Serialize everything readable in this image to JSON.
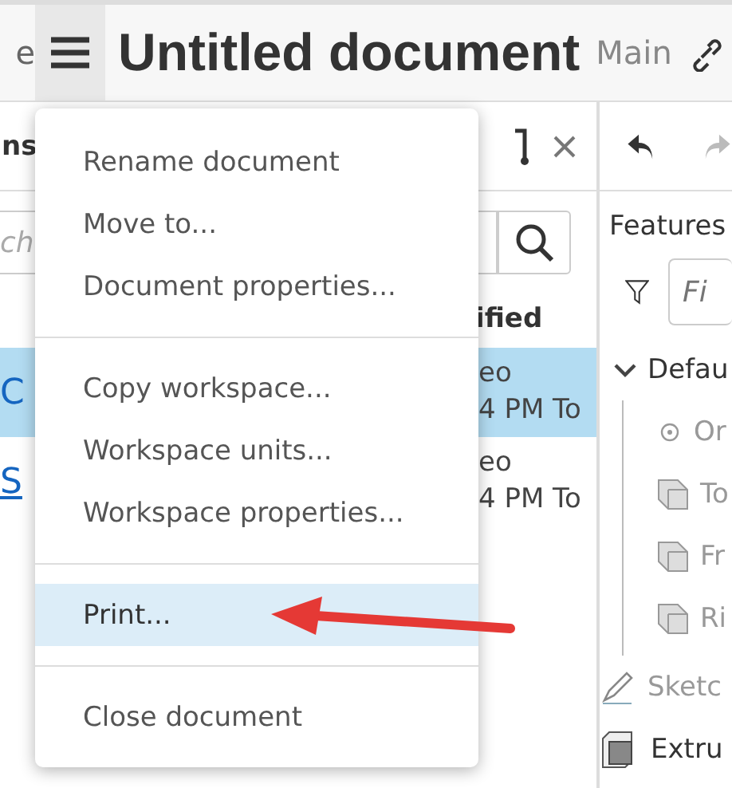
{
  "header": {
    "left_text": "e",
    "title": "Untitled document",
    "branch": "Main"
  },
  "left_panel": {
    "title": "ns",
    "search": {
      "placeholder": "ch"
    },
    "column_header": "ified",
    "rows": [
      {
        "selected": true,
        "lead": "C",
        "line_1": "eo",
        "line_2": "4 PM To"
      },
      {
        "selected": false,
        "lead": "S",
        "line_1": "eo",
        "line_2": "4 PM To"
      }
    ]
  },
  "feature_panel": {
    "title": "Features",
    "filter": {
      "placeholder": "Fi"
    },
    "tree": [
      {
        "label": "Defau",
        "kind": "folder",
        "expanded": true,
        "children": [
          {
            "label": "Or",
            "kind": "origin"
          },
          {
            "label": "To",
            "kind": "plane"
          },
          {
            "label": "Fr",
            "kind": "plane"
          },
          {
            "label": "Ri",
            "kind": "plane"
          }
        ]
      },
      {
        "label": "Sketc",
        "kind": "sketch"
      },
      {
        "label": "Extru",
        "kind": "extrude"
      }
    ]
  },
  "menu": {
    "groups": [
      [
        {
          "label": "Rename document",
          "selected": false
        },
        {
          "label": "Move to...",
          "selected": false
        },
        {
          "label": "Document properties...",
          "selected": false
        }
      ],
      [
        {
          "label": "Copy workspace...",
          "selected": false
        },
        {
          "label": "Workspace units...",
          "selected": false
        },
        {
          "label": "Workspace properties...",
          "selected": false
        }
      ],
      [
        {
          "label": "Print...",
          "selected": true
        }
      ],
      [
        {
          "label": "Close document",
          "selected": false
        }
      ]
    ]
  }
}
